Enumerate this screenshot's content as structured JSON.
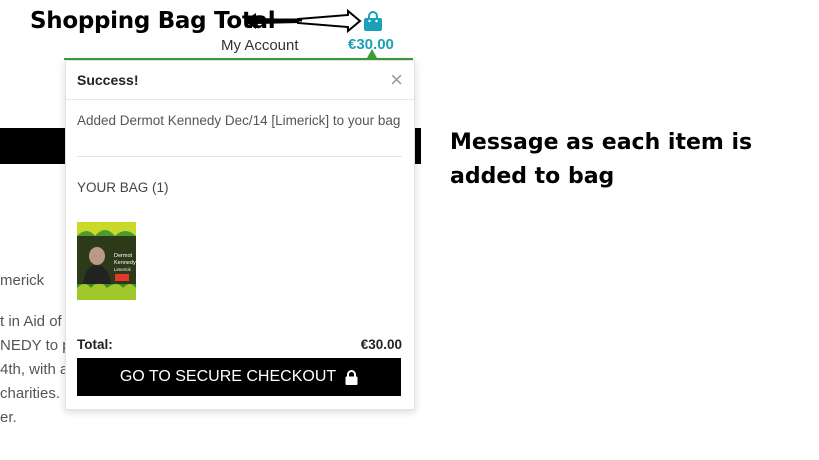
{
  "annotations": {
    "bag_total_label": "Shopping Bag Total",
    "message_line1": "Message as each item is",
    "message_line2": "added to bag"
  },
  "header": {
    "my_account": "My Account",
    "bag_total": "€30.00",
    "bag_icon": "shopping-bag-icon"
  },
  "background_text": [
    "merick",
    "t in Aid of",
    "NEDY to p",
    "4th, with a",
    "charities.",
    "er."
  ],
  "popup": {
    "title": "Success!",
    "close": "×",
    "message": "Added Dermot Kennedy Dec/14 [Limerick] to your bag",
    "bag_count": "YOUR BAG (1)",
    "item_poster": {
      "line1": "Dermot",
      "line2": "Kennedy",
      "line3": "Limerick"
    },
    "total_label": "Total:",
    "total_value": "€30.00",
    "checkout_label": "GO TO SECURE CHECKOUT",
    "checkout_icon": "lock-icon"
  },
  "colors": {
    "accent": "#1aa1b8",
    "nav_green": "#3a9f3a",
    "button_bg": "#000000"
  }
}
